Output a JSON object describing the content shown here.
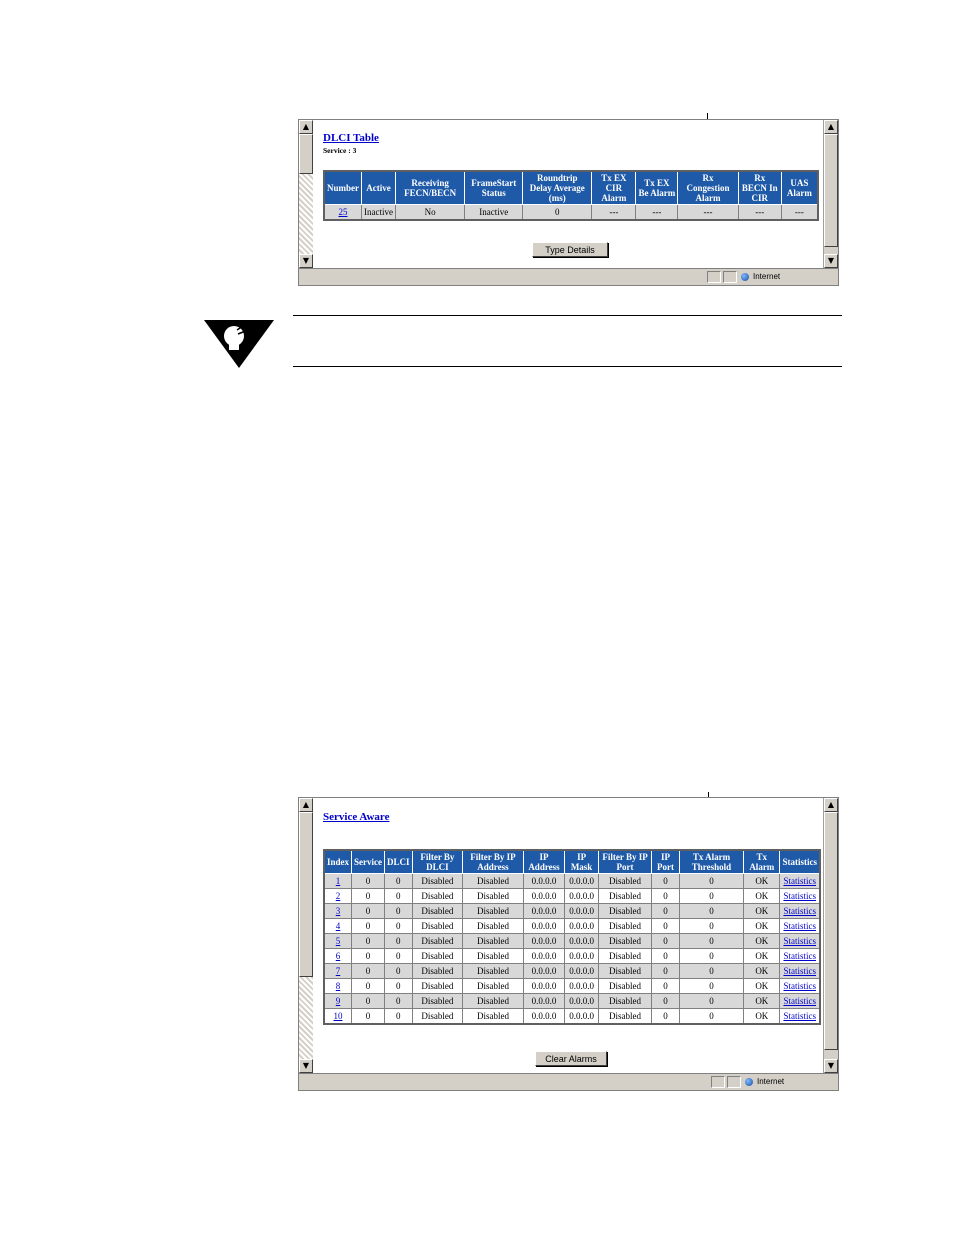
{
  "window1": {
    "title": "DLCI Table",
    "subtitle": "Service : 3",
    "headers": [
      "Number",
      "Active",
      "Receiving FECN/BECN",
      "FrameStart Status",
      "Roundtrip Delay Average (ms)",
      "Tx EX CIR Alarm",
      "Tx EX Be Alarm",
      "Rx Congestion Alarm",
      "Rx BECN In CIR",
      "UAS Alarm"
    ],
    "rows": [
      [
        "25",
        "Inactive",
        "No",
        "Inactive",
        "0",
        "---",
        "---",
        "---",
        "---",
        "---"
      ]
    ],
    "button_label": "Type Details",
    "status_zone": "Internet"
  },
  "window2": {
    "title": "Service Aware",
    "headers": [
      "Index",
      "Service",
      "DLCI",
      "Filter By DLCI",
      "Filter By IP Address",
      "IP Address",
      "IP Mask",
      "Filter By IP Port",
      "IP Port",
      "Tx Alarm Threshold",
      "Tx Alarm",
      "Statistics"
    ],
    "rows": [
      [
        "1",
        "0",
        "0",
        "Disabled",
        "Disabled",
        "0.0.0.0",
        "0.0.0.0",
        "Disabled",
        "0",
        "0",
        "OK",
        "Statistics"
      ],
      [
        "2",
        "0",
        "0",
        "Disabled",
        "Disabled",
        "0.0.0.0",
        "0.0.0.0",
        "Disabled",
        "0",
        "0",
        "OK",
        "Statistics"
      ],
      [
        "3",
        "0",
        "0",
        "Disabled",
        "Disabled",
        "0.0.0.0",
        "0.0.0.0",
        "Disabled",
        "0",
        "0",
        "OK",
        "Statistics"
      ],
      [
        "4",
        "0",
        "0",
        "Disabled",
        "Disabled",
        "0.0.0.0",
        "0.0.0.0",
        "Disabled",
        "0",
        "0",
        "OK",
        "Statistics"
      ],
      [
        "5",
        "0",
        "0",
        "Disabled",
        "Disabled",
        "0.0.0.0",
        "0.0.0.0",
        "Disabled",
        "0",
        "0",
        "OK",
        "Statistics"
      ],
      [
        "6",
        "0",
        "0",
        "Disabled",
        "Disabled",
        "0.0.0.0",
        "0.0.0.0",
        "Disabled",
        "0",
        "0",
        "OK",
        "Statistics"
      ],
      [
        "7",
        "0",
        "0",
        "Disabled",
        "Disabled",
        "0.0.0.0",
        "0.0.0.0",
        "Disabled",
        "0",
        "0",
        "OK",
        "Statistics"
      ],
      [
        "8",
        "0",
        "0",
        "Disabled",
        "Disabled",
        "0.0.0.0",
        "0.0.0.0",
        "Disabled",
        "0",
        "0",
        "OK",
        "Statistics"
      ],
      [
        "9",
        "0",
        "0",
        "Disabled",
        "Disabled",
        "0.0.0.0",
        "0.0.0.0",
        "Disabled",
        "0",
        "0",
        "OK",
        "Statistics"
      ],
      [
        "10",
        "0",
        "0",
        "Disabled",
        "Disabled",
        "0.0.0.0",
        "0.0.0.0",
        "Disabled",
        "0",
        "0",
        "OK",
        "Statistics"
      ]
    ],
    "button_label": "Clear Alarms",
    "status_zone": "Internet"
  },
  "note": {
    "icon": "lightbulb-hint-icon"
  },
  "colors": {
    "header_bg": "#1f5aa8",
    "link": "#0000cc",
    "chrome": "#d4d0c8"
  }
}
